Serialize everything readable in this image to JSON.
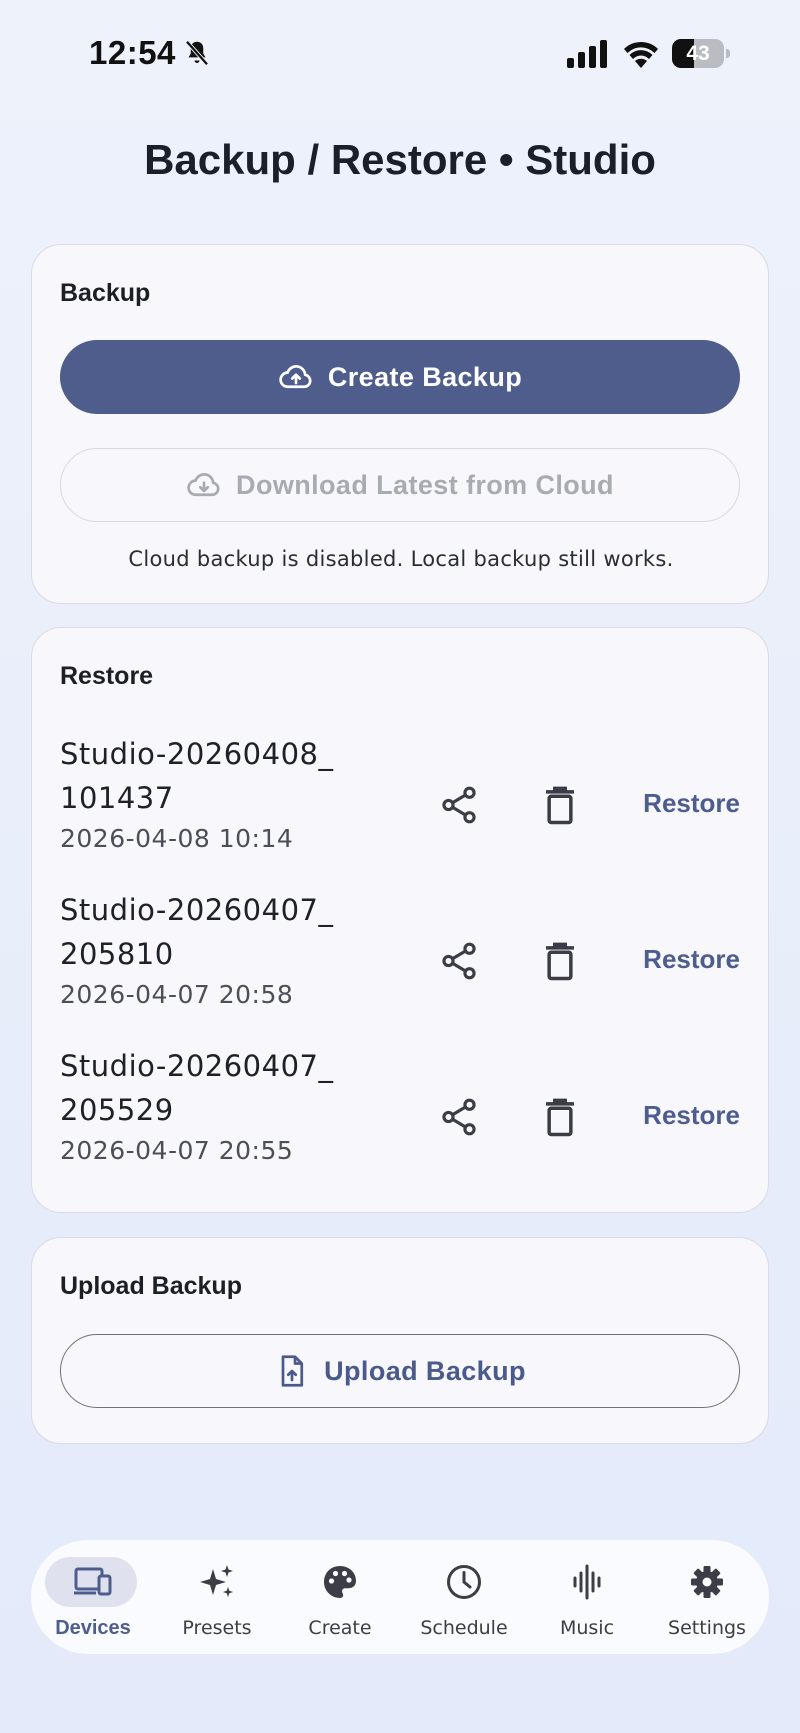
{
  "status_bar": {
    "time": "12:54",
    "battery": "43",
    "battery_level": 0.43
  },
  "page_title": "Backup / Restore • Studio",
  "backup_card": {
    "title": "Backup",
    "create_label": "Create Backup",
    "download_label": "Download Latest from Cloud",
    "note": "Cloud backup is disabled. Local backup still works."
  },
  "restore_card": {
    "title": "Restore",
    "items": [
      {
        "name": "Studio-20260408_\n101437",
        "date": "2026-04-08 10:14",
        "action": "Restore"
      },
      {
        "name": "Studio-20260407_\n205810",
        "date": "2026-04-07 20:58",
        "action": "Restore"
      },
      {
        "name": "Studio-20260407_\n205529",
        "date": "2026-04-07 20:55",
        "action": "Restore"
      }
    ]
  },
  "upload_card": {
    "title": "Upload Backup",
    "button_label": "Upload Backup"
  },
  "nav": {
    "items": [
      {
        "label": "Devices",
        "icon": "devices-icon",
        "active": true
      },
      {
        "label": "Presets",
        "icon": "sparkle-icon",
        "active": false
      },
      {
        "label": "Create",
        "icon": "palette-icon",
        "active": false
      },
      {
        "label": "Schedule",
        "icon": "clock-icon",
        "active": false
      },
      {
        "label": "Music",
        "icon": "waveform-icon",
        "active": false
      },
      {
        "label": "Settings",
        "icon": "gear-icon",
        "active": false
      }
    ]
  },
  "colors": {
    "accent": "#4e5d8c",
    "accent_text": "#4d5d8e",
    "card_bg": "#f7f7fc",
    "page_bg": "#e9eefa"
  }
}
